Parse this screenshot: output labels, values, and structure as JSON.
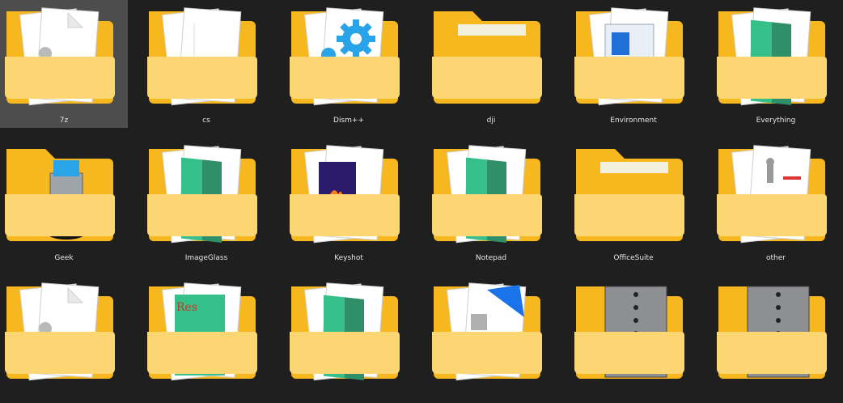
{
  "folders": [
    {
      "name": "7z",
      "preview": "7z-file-icon",
      "selected": true
    },
    {
      "name": "cs",
      "preview": "blank-documents-icon",
      "selected": false
    },
    {
      "name": "Dism++",
      "preview": "gear-icon",
      "selected": false
    },
    {
      "name": "dji",
      "preview": "empty-folder-icon",
      "selected": false
    },
    {
      "name": "Environment",
      "preview": "settings-window-icon",
      "selected": false
    },
    {
      "name": "Everything",
      "preview": "green-book-icon",
      "selected": false
    },
    {
      "name": "Geek",
      "preview": "recycle-bin-icon",
      "selected": false
    },
    {
      "name": "ImageGlass",
      "preview": "green-book-icon",
      "selected": false
    },
    {
      "name": "Keyshot",
      "preview": "keyshot-logo-icon",
      "selected": false
    },
    {
      "name": "Notepad",
      "preview": "green-book-icon",
      "selected": false
    },
    {
      "name": "OfficeSuite",
      "preview": "empty-folder-icon",
      "selected": false
    },
    {
      "name": "other",
      "preview": "robot-image-icon",
      "selected": false
    },
    {
      "name": "",
      "preview": "7z-file-icon",
      "selected": false
    },
    {
      "name": "",
      "preview": "resources-book-icon",
      "selected": false
    },
    {
      "name": "",
      "preview": "green-book-icon",
      "selected": false
    },
    {
      "name": "",
      "preview": "blue-document-icon",
      "selected": false
    },
    {
      "name": "",
      "preview": "spiral-notebook-icon",
      "selected": false
    },
    {
      "name": "",
      "preview": "spiral-notebook-icon",
      "selected": false
    }
  ],
  "colors": {
    "background": "#1f1f1f",
    "selection": "#4d4d4d",
    "folder_back": "#f6b81e",
    "folder_front": "#fbd672",
    "label_text": "#e6e6e6",
    "accent_blue": "#2aa4e8",
    "accent_green": "#35c08a"
  }
}
